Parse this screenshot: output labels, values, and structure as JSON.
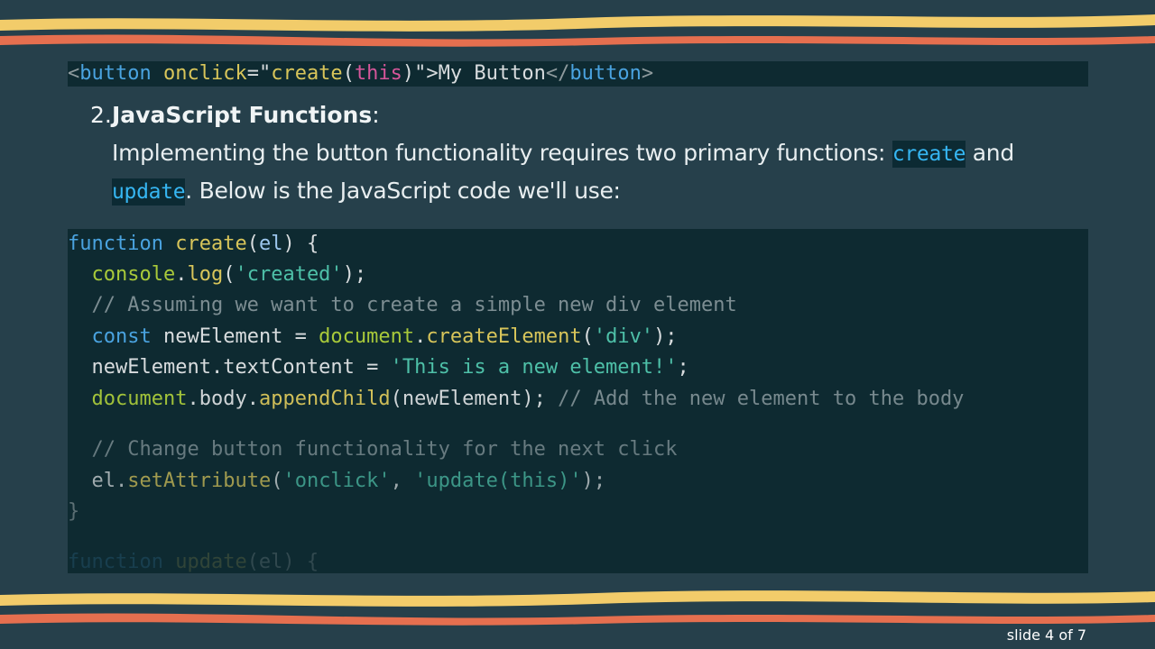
{
  "html_snippet": {
    "lt1": "<",
    "tag_open": "button",
    "attr": "onclick",
    "eq_q": "=\"",
    "fn_call": "create",
    "paren_o": "(",
    "this_kw": "this",
    "paren_c": ")",
    "q_gt": "\">",
    "inner": "My Button",
    "lt2": "</",
    "tag_close": "button",
    "gt": ">"
  },
  "section": {
    "number": "2.",
    "title": "JavaScript Functions",
    "colon": ":",
    "line1_text": "Implementing the button functionality requires two primary functions: ",
    "line1_code": "create",
    "line1_end": " and",
    "line2_code": "update",
    "line2_text": ". Below is the JavaScript code we'll use:"
  },
  "code": {
    "l1": {
      "kw": "function",
      "name": "create",
      "open": "(",
      "param": "el",
      "close": ") {"
    },
    "l2": {
      "obj": "console",
      "dot": ".",
      "method": "log",
      "open": "(",
      "str": "'created'",
      "close": ");"
    },
    "l3": {
      "comment": "// Assuming we want to create a simple new div element"
    },
    "l4": {
      "kw": "const",
      "var": " newElement = ",
      "obj": "document",
      "dot": ".",
      "method": "createElement",
      "open": "(",
      "str": "'div'",
      "close": ");"
    },
    "l5": {
      "text": "newElement.textContent = ",
      "str": "'This is a new element!'",
      "close": ";"
    },
    "l6": {
      "obj": "document",
      "mid": ".body.",
      "method": "appendChild",
      "args": "(newElement); ",
      "comment": "// Add the new element to the body"
    },
    "l7": {
      "comment": "// Change button functionality for the next click"
    },
    "l8": {
      "obj": "el.",
      "method": "setAttribute",
      "open": "(",
      "str1": "'onclick'",
      "sep": ", ",
      "str2": "'update(this)'",
      "close": ");"
    },
    "l9": {
      "brace": "}"
    },
    "l10": {
      "kw": "function",
      "name": " update",
      "rest": "(el) {"
    }
  },
  "footer": {
    "slide_label": "slide 4 of 7"
  },
  "colors": {
    "background": "#26404b",
    "wave_yellow": "#f2cc6a",
    "wave_orange": "#e56f4f",
    "code_bg": "#0e2a31",
    "inline_code": "#36b6f2"
  }
}
